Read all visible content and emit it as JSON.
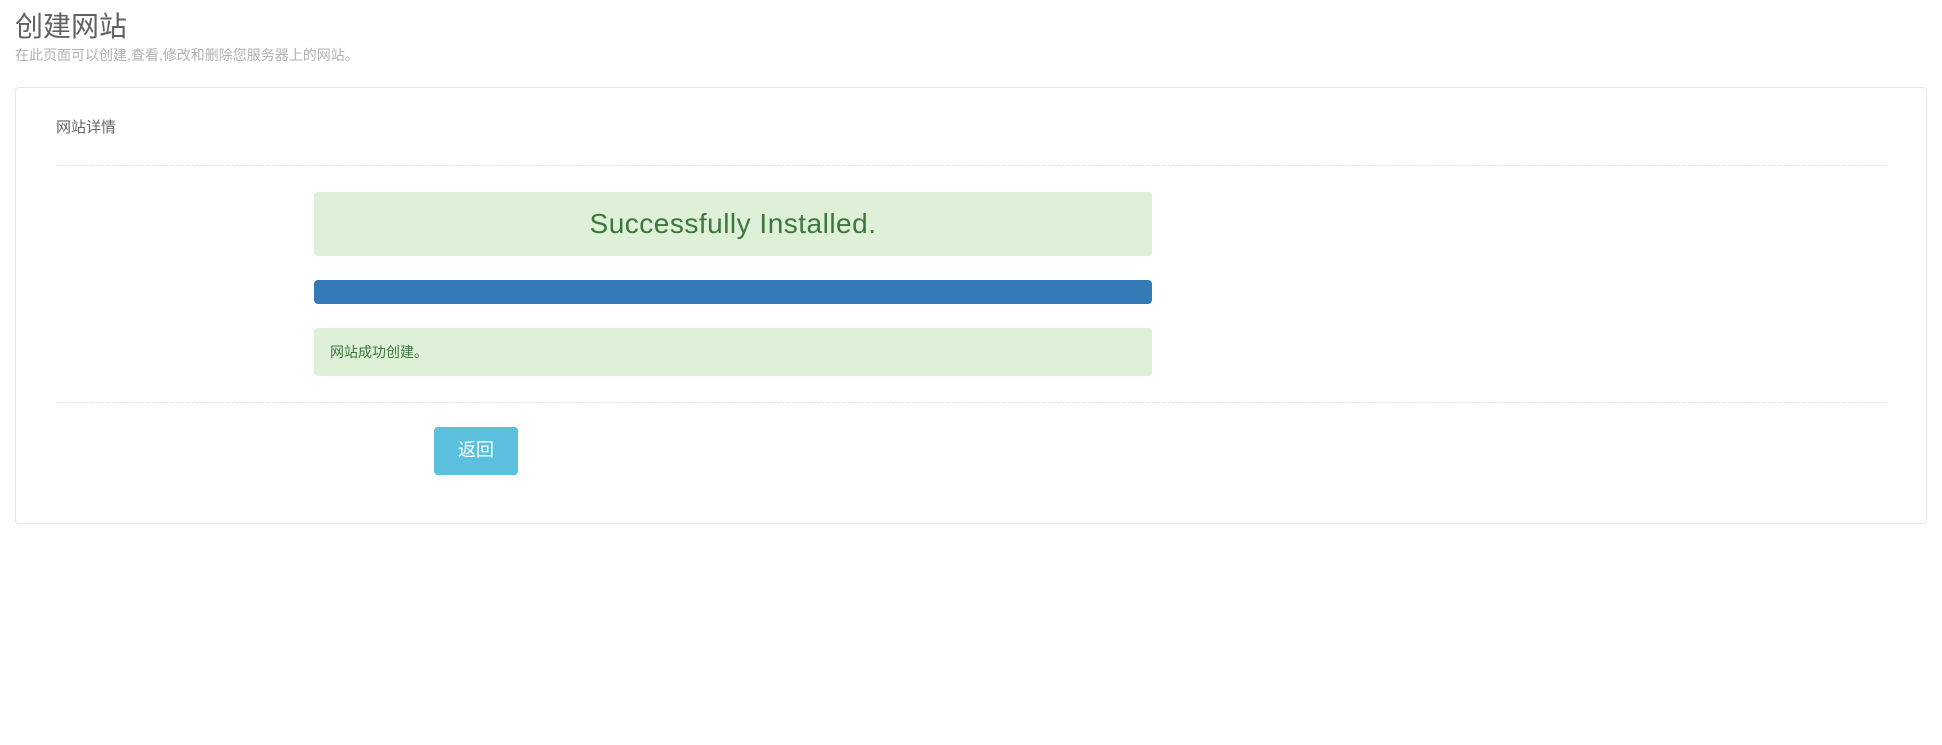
{
  "header": {
    "title": "创建网站",
    "subtitle": "在此页面可以创建,查看,修改和删除您服务器上的网站。"
  },
  "panel": {
    "section_title": "网站详情",
    "install_status": "Successfully Installed.",
    "progress_percent": 100,
    "create_message": "网站成功创建。",
    "back_label": "返回"
  }
}
